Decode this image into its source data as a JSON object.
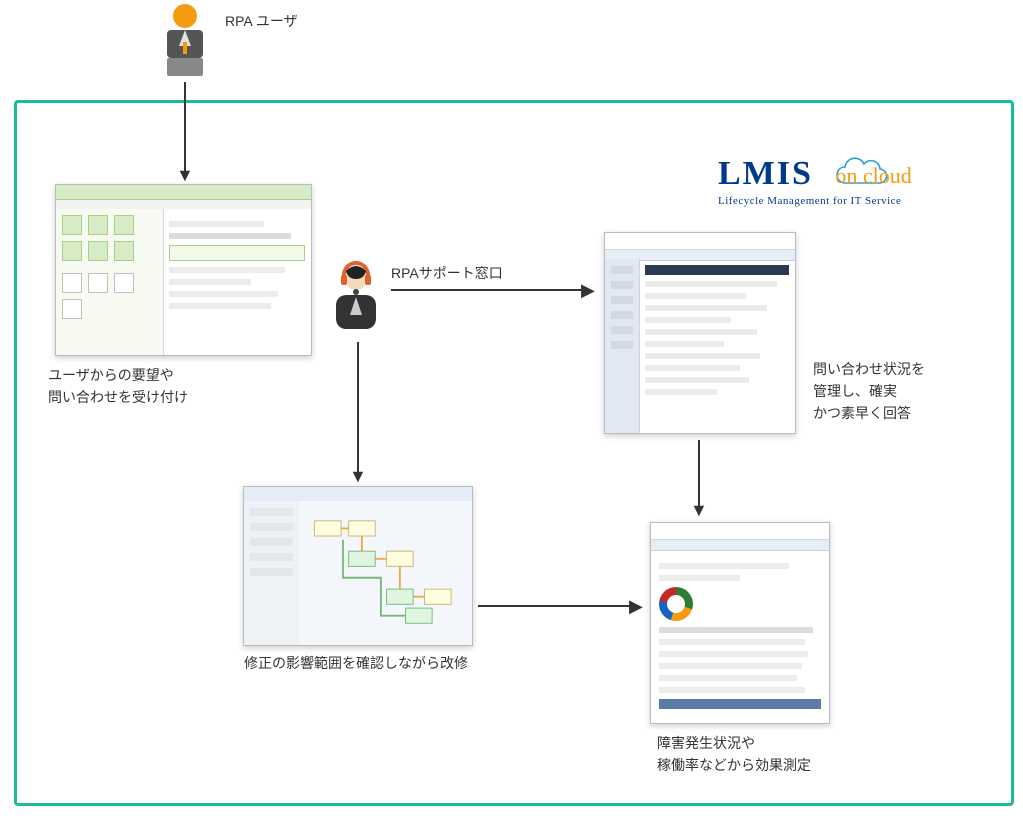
{
  "labels": {
    "rpa_user": "RPA ユーザ",
    "rpa_support": "RPAサポート窓口",
    "box1_line1": "ユーザからの要望や",
    "box1_line2": "問い合わせを受け付け",
    "box3_line1": "問い合わせ状況を",
    "box3_line2": "管理し、確実",
    "box3_line3": "かつ素早く回答",
    "box2_line1": "修正の影響範囲を確認しながら改修",
    "box4_line1": "障害発生状況や",
    "box4_line2": "稼働率などから効果測定"
  },
  "logo": {
    "main": "LMIS",
    "sub": "on cloud",
    "tagline": "Lifecycle Management for IT Service"
  }
}
